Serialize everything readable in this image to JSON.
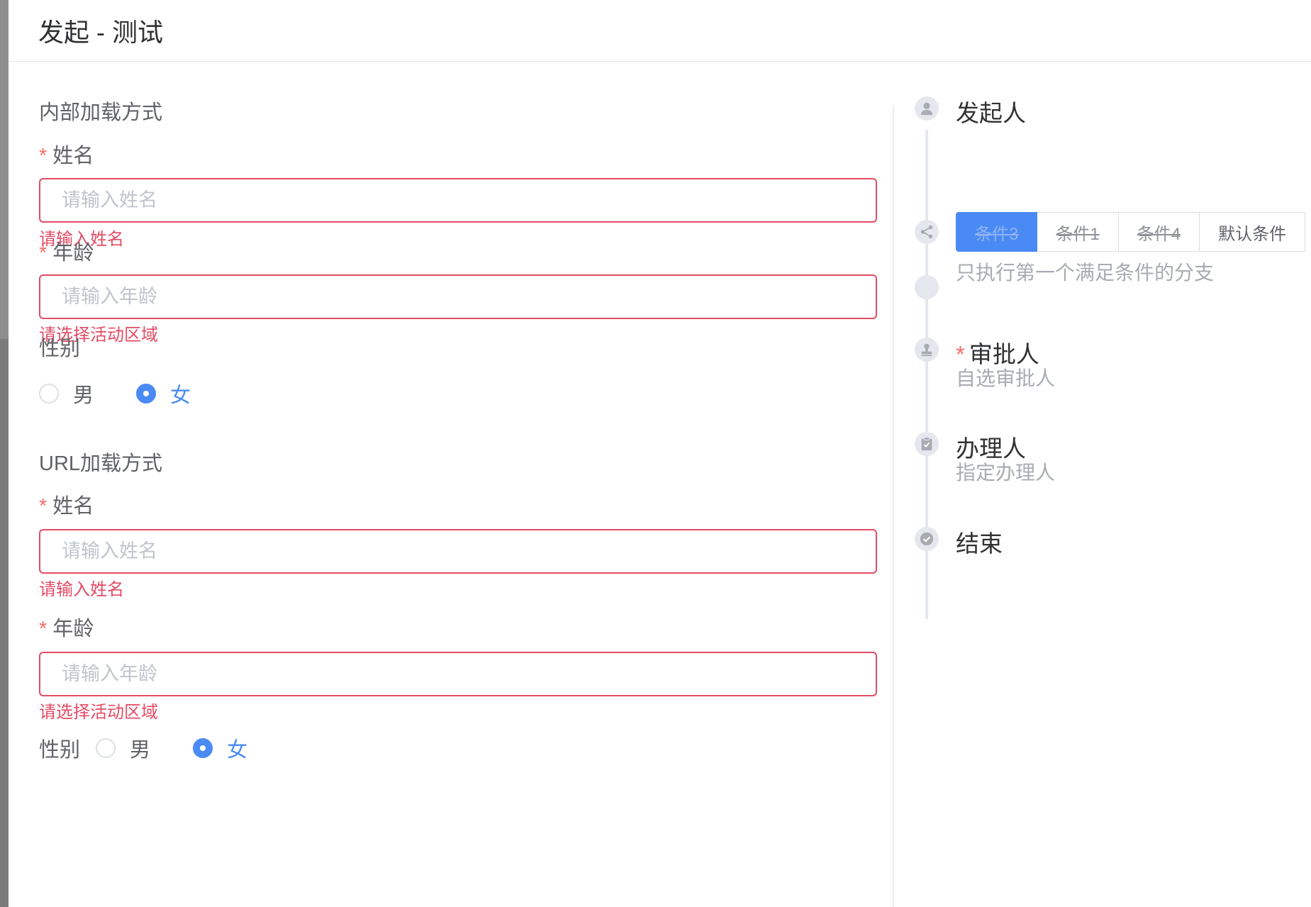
{
  "dialog": {
    "title": "发起 - 测试"
  },
  "internal": {
    "section_title": "内部加载方式",
    "name_label": "姓名",
    "name_placeholder": "请输入姓名",
    "name_error": "请输入姓名",
    "age_label": "年龄",
    "age_placeholder": "请输入年龄",
    "age_error": "请选择活动区域",
    "gender_label": "性别",
    "gender_options": [
      "男",
      "女"
    ],
    "gender_selected": "女"
  },
  "url": {
    "section_title": "URL加载方式",
    "name_label": "姓名",
    "name_placeholder": "请输入姓名",
    "name_error": "请输入姓名",
    "age_label": "年龄",
    "age_placeholder": "请输入年龄",
    "age_error": "请选择活动区域",
    "gender_label": "性别",
    "gender_options": [
      "男",
      "女"
    ],
    "gender_selected": "女"
  },
  "required_mark": "*",
  "timeline": {
    "initiator": {
      "title": "发起人",
      "icon": "user-icon"
    },
    "condition": {
      "icon": "share-icon",
      "tabs": [
        {
          "label": "条件3",
          "state": "active-disabled"
        },
        {
          "label": "条件1",
          "state": "disabled"
        },
        {
          "label": "条件4",
          "state": "disabled"
        },
        {
          "label": "默认条件",
          "state": "normal"
        }
      ],
      "hint": "只执行第一个满足条件的分支"
    },
    "approver": {
      "title": "审批人",
      "sub": "自选审批人",
      "icon": "stamp-icon"
    },
    "handler": {
      "title": "办理人",
      "sub": "指定办理人",
      "icon": "clipboard-check-icon"
    },
    "end": {
      "title": "结束",
      "icon": "check-circle-icon"
    }
  },
  "colors": {
    "accent": "#4a8af4",
    "error": "#e44b64",
    "required": "#f56c6c"
  }
}
